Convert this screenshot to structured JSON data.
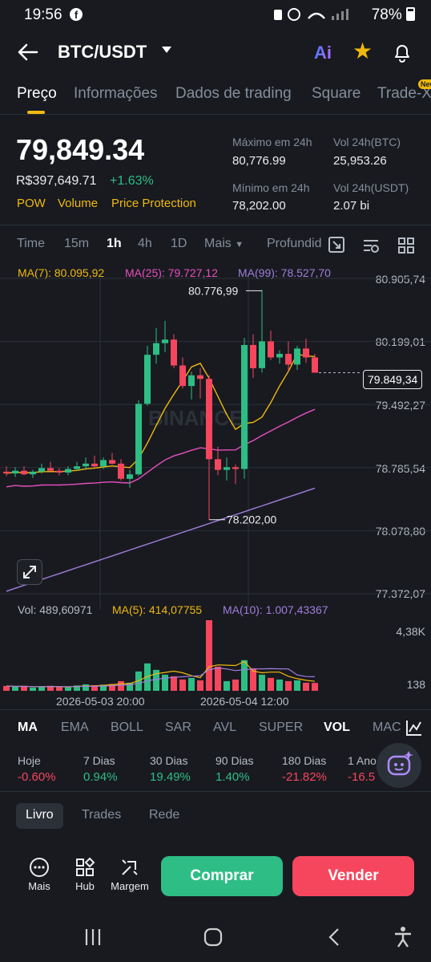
{
  "status_bar": {
    "time": "19:56",
    "battery": "78%",
    "fb": "f"
  },
  "header": {
    "pair": "BTC/USDT",
    "ai_label": "Ai"
  },
  "tabs": [
    "Preço",
    "Informações",
    "Dados de trading",
    "Square",
    "Trade-X"
  ],
  "new_badge": "New",
  "ticker": {
    "price": "79,849.34",
    "fiat": "R$397,649.71",
    "change": "+1.63%",
    "tags": [
      "POW",
      "Volume",
      "Price Protection"
    ],
    "high_label": "Máximo em 24h",
    "high": "80,776.99",
    "low_label": "Mínimo em 24h",
    "low": "78,202.00",
    "vol_btc_label": "Vol 24h(BTC)",
    "vol_btc": "25,953.26",
    "vol_usdt_label": "Vol 24h(USDT)",
    "vol_usdt": "2.07 bi"
  },
  "timeframes": [
    "Time",
    "15m",
    "1h",
    "4h",
    "1D",
    "Mais",
    "Profundid"
  ],
  "ma": {
    "ma7": "MA(7): 80.095,92",
    "ma25": "MA(25): 79.727,12",
    "ma99": "MA(99): 78.527,70"
  },
  "price_axis": [
    "80.905,74",
    "80.199,01",
    "79.492,27",
    "78.785,54",
    "78.078,80",
    "77.372,07"
  ],
  "current_price_tag": "79.849,34",
  "high_marker": "80.776,99",
  "low_marker": "78.202,00",
  "watermark": "BINANCE",
  "volume": {
    "vol": "Vol: 489,60971",
    "ma5": "MA(5): 414,07755",
    "ma10": "MA(10): 1.007,43367",
    "axis_top": "4,38K",
    "axis_bottom": "138"
  },
  "time_axis": [
    "2026-05-03 20:00",
    "2026-05-04 12:00"
  ],
  "indicators": [
    "MA",
    "EMA",
    "BOLL",
    "SAR",
    "AVL",
    "SUPER",
    "VOL",
    "MACD"
  ],
  "performance": [
    {
      "label": "Hoje",
      "value": "-0.60%",
      "dir": "red"
    },
    {
      "label": "7 Dias",
      "value": "0.94%",
      "dir": "green"
    },
    {
      "label": "30 Dias",
      "value": "19.49%",
      "dir": "green"
    },
    {
      "label": "90 Dias",
      "value": "1.40%",
      "dir": "green"
    },
    {
      "label": "180 Dias",
      "value": "-21.82%",
      "dir": "red"
    },
    {
      "label": "1 Ano",
      "value": "-16.5",
      "dir": "red"
    }
  ],
  "bottom_tabs": [
    "Livro",
    "Trades",
    "Rede"
  ],
  "tools": [
    "Mais",
    "Hub",
    "Margem"
  ],
  "buy_label": "Comprar",
  "sell_label": "Vender",
  "colors": {
    "up": "#2ebd85",
    "down": "#f6465d",
    "accent": "#f0b90b",
    "ma7": "#f0b90b",
    "ma25": "#e84fc0",
    "ma99": "#a27ddb",
    "bg": "#181a20"
  },
  "chart_data": {
    "type": "candlestick",
    "title": "BTC/USDT 1h",
    "candles": [
      {
        "o": 78740,
        "h": 78800,
        "l": 78690,
        "c": 78720
      },
      {
        "o": 78720,
        "h": 78790,
        "l": 78680,
        "c": 78750
      },
      {
        "o": 78750,
        "h": 78800,
        "l": 78700,
        "c": 78710
      },
      {
        "o": 78710,
        "h": 78760,
        "l": 78670,
        "c": 78740
      },
      {
        "o": 78740,
        "h": 78830,
        "l": 78720,
        "c": 78780
      },
      {
        "o": 78780,
        "h": 78850,
        "l": 78740,
        "c": 78750
      },
      {
        "o": 78750,
        "h": 78780,
        "l": 78700,
        "c": 78730
      },
      {
        "o": 78730,
        "h": 78800,
        "l": 78700,
        "c": 78770
      },
      {
        "o": 78770,
        "h": 78850,
        "l": 78750,
        "c": 78800
      },
      {
        "o": 78800,
        "h": 78900,
        "l": 78760,
        "c": 78830
      },
      {
        "o": 78830,
        "h": 78920,
        "l": 78780,
        "c": 78800
      },
      {
        "o": 78800,
        "h": 78900,
        "l": 78770,
        "c": 78870
      },
      {
        "o": 78870,
        "h": 78950,
        "l": 78820,
        "c": 78830
      },
      {
        "o": 78830,
        "h": 78880,
        "l": 78640,
        "c": 78660
      },
      {
        "o": 78660,
        "h": 78760,
        "l": 78560,
        "c": 78710
      },
      {
        "o": 78710,
        "h": 79540,
        "l": 78690,
        "c": 79500
      },
      {
        "o": 79500,
        "h": 80150,
        "l": 79480,
        "c": 80050
      },
      {
        "o": 80050,
        "h": 80350,
        "l": 79950,
        "c": 80180
      },
      {
        "o": 80180,
        "h": 80430,
        "l": 80080,
        "c": 80220
      },
      {
        "o": 80220,
        "h": 80280,
        "l": 79900,
        "c": 79930
      },
      {
        "o": 79930,
        "h": 80020,
        "l": 79670,
        "c": 79700
      },
      {
        "o": 79700,
        "h": 79860,
        "l": 79550,
        "c": 79820
      },
      {
        "o": 79820,
        "h": 79900,
        "l": 79560,
        "c": 79780
      },
      {
        "o": 79780,
        "h": 79820,
        "l": 78202,
        "c": 78880
      },
      {
        "o": 78880,
        "h": 79020,
        "l": 78700,
        "c": 78760
      },
      {
        "o": 78760,
        "h": 78900,
        "l": 78640,
        "c": 78790
      },
      {
        "o": 78790,
        "h": 78820,
        "l": 78600,
        "c": 78770
      },
      {
        "o": 78770,
        "h": 80240,
        "l": 78660,
        "c": 80160
      },
      {
        "o": 80160,
        "h": 80280,
        "l": 79790,
        "c": 79900
      },
      {
        "o": 79900,
        "h": 80776.99,
        "l": 79850,
        "c": 80200
      },
      {
        "o": 80200,
        "h": 80320,
        "l": 79990,
        "c": 80020
      },
      {
        "o": 80020,
        "h": 80100,
        "l": 79950,
        "c": 80060
      },
      {
        "o": 80060,
        "h": 80200,
        "l": 79870,
        "c": 79940
      },
      {
        "o": 79940,
        "h": 80150,
        "l": 79880,
        "c": 80120
      },
      {
        "o": 80120,
        "h": 80230,
        "l": 79960,
        "c": 80020
      },
      {
        "o": 80020,
        "h": 80060,
        "l": 79849,
        "c": 79849
      }
    ],
    "volumes": [
      300,
      250,
      280,
      200,
      260,
      310,
      240,
      220,
      330,
      400,
      350,
      380,
      420,
      600,
      500,
      1200,
      1700,
      1300,
      1000,
      900,
      700,
      800,
      650,
      4380,
      1500,
      600,
      700,
      1900,
      1400,
      1000,
      800,
      700,
      600,
      650,
      500,
      490
    ],
    "ylim": [
      77372.07,
      80905.74
    ],
    "volume_max": 4380,
    "grid": true
  }
}
